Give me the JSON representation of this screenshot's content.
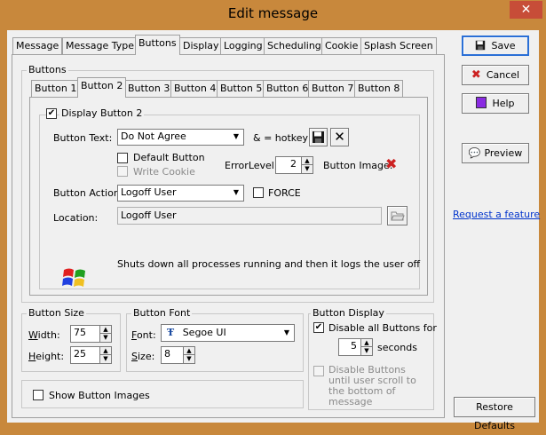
{
  "window": {
    "title": "Edit message",
    "close": "✕"
  },
  "tabs": [
    "Message",
    "Message Type",
    "Buttons",
    "Display",
    "Logging",
    "Scheduling",
    "Cookie",
    "Splash Screen"
  ],
  "buttons_group": {
    "title": "Buttons",
    "subtabs": [
      "Button 1",
      "Button 2",
      "Button 3",
      "Button 4",
      "Button 5",
      "Button 6",
      "Button 7",
      "Button 8"
    ],
    "display_checkbox": "Display Button 2",
    "button_text_label": "Button Text:",
    "button_text_value": "Do Not Agree",
    "hotkey_note": "& = hotkey",
    "default_button": "Default Button",
    "write_cookie": "Write Cookie",
    "error_level_label": "ErrorLevel:",
    "error_level_value": "2",
    "button_image_label": "Button Image:",
    "button_action_label": "Button Action:",
    "button_action_value": "Logoff User",
    "force_label": "FORCE",
    "location_label": "Location:",
    "location_value": "Logoff User",
    "action_description": "Shuts down all processes running and then it logs the user off"
  },
  "button_size": {
    "title": "Button Size",
    "width_label": "Width:",
    "width_value": "75",
    "height_label": "Height:",
    "height_value": "25"
  },
  "button_font": {
    "title": "Button Font",
    "font_label": "Font:",
    "font_value": "Segoe UI",
    "size_label": "Size:",
    "size_value": "8"
  },
  "button_display": {
    "title": "Button Display",
    "disable_all": "Disable all Buttons for",
    "seconds_value": "5",
    "seconds_label": "seconds",
    "disable_until": "Disable Buttons until user scroll to the bottom of message"
  },
  "show_images": "Show Button Images",
  "side_buttons": {
    "save": "Save",
    "cancel": "Cancel",
    "help": "Help",
    "preview": "Preview",
    "request": "Request a feature",
    "restore": "Restore Defaults"
  },
  "colors": {
    "accent_link": "#0033cc",
    "error_red": "#cc2222",
    "title_bg": "#c8883c"
  }
}
